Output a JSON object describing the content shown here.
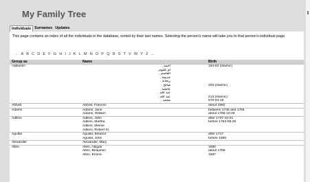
{
  "title": "My Family Tree",
  "nav": [
    "Individuals",
    "Surnames",
    "Updates"
  ],
  "intro": "This page contains an index of all the individuals in the database, sorted by their last names. Selecting the person's name will take you to that person's individual page.",
  "alphabet": [
    "A",
    "B",
    "C",
    "D",
    "E",
    "F",
    "G",
    "H",
    "I",
    "J",
    "K",
    "L",
    "M",
    "N",
    "O",
    "P",
    "Q",
    "R",
    "S",
    "T",
    "V",
    "W",
    "Y",
    "Z"
  ],
  "table": {
    "headers": [
      "Group as",
      "Name",
      "Birth"
    ],
    "groups": [
      {
        "group": "<absent>",
        "rows": [
          {
            "name": "أحمد ,",
            "birth": "164-03 (Islamic)"
          },
          {
            "name": "أم كلثوم ,",
            "birth": ""
          },
          {
            "name": "القاسم ,",
            "birth": ""
          },
          {
            "name": "خديجة ,",
            "birth": ""
          },
          {
            "name": "ريحانة ,",
            "birth": ""
          },
          {
            "name": "صالح ,",
            "birth": "203 (Islamic)"
          },
          {
            "name": "عائشة ,",
            "birth": ""
          },
          {
            "name": "عبد الله ,",
            "birth": ""
          },
          {
            "name": "عبد الله ,",
            "birth": "213 (Islamic)"
          },
          {
            "name": "محمد ,",
            "birth": "570-04-19"
          }
        ]
      },
      {
        "group": "Abbott",
        "rows": [
          {
            "name": "Abbott, Frances",
            "birth": "about 1592"
          }
        ]
      },
      {
        "group": "Adams",
        "rows": [
          {
            "name": "Adams, Jane",
            "birth": "between 1745 and 1755"
          },
          {
            "name": "Adams, William",
            "birth": "about 1766-10-26"
          }
        ]
      },
      {
        "group": "Adkins",
        "rows": [
          {
            "name": "Adkins, John",
            "birth": "after 1737-10-01"
          },
          {
            "name": "Adkins, Martha",
            "birth": "before 1763-06-29"
          },
          {
            "name": "Adkins, Minnie",
            "birth": ""
          },
          {
            "name": "Adkins, Robert Sr.",
            "birth": ""
          }
        ]
      },
      {
        "group": "Aguilar",
        "rows": [
          {
            "name": "Aguilar, Eleanor",
            "birth": "after 1717"
          },
          {
            "name": "Aguilar, John",
            "birth": "before 1665"
          }
        ]
      },
      {
        "group": "Alexander",
        "rows": [
          {
            "name": "Alexander, Mary",
            "birth": ""
          }
        ]
      },
      {
        "group": "Allen",
        "rows": [
          {
            "name": "Allen, Abigail",
            "birth": "1690"
          },
          {
            "name": "Allen, Benjamin",
            "birth": "about 1789"
          },
          {
            "name": "Allen, Emma",
            "birth": "1667"
          }
        ]
      }
    ]
  }
}
